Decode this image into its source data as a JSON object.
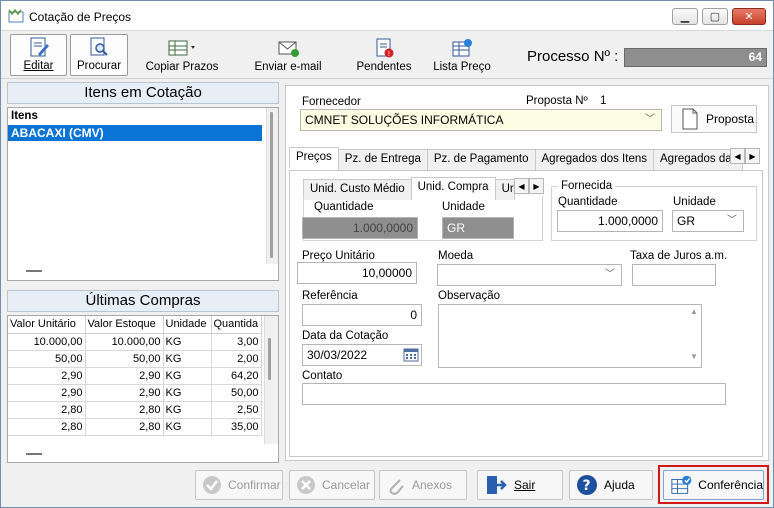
{
  "window": {
    "title": "Cotação de Preços"
  },
  "toolbar": {
    "editar": "Editar",
    "procurar": "Procurar",
    "copiar_prazos": "Copiar Prazos",
    "enviar_email": "Enviar e-mail",
    "pendentes": "Pendentes",
    "lista_preco": "Lista Preço"
  },
  "processo": {
    "label": "Processo Nº :",
    "value": "64"
  },
  "itens": {
    "header": "Itens em Cotação",
    "column": "Itens",
    "items": [
      "ABACAXI (CMV)"
    ]
  },
  "ultimas": {
    "header": "Últimas Compras",
    "columns": [
      "Valor Unitário",
      "Valor Estoque",
      "Unidade",
      "Quantida"
    ],
    "rows": [
      [
        "10.000,00",
        "10.000,00",
        "KG",
        "3,00"
      ],
      [
        "50,00",
        "50,00",
        "KG",
        "2,00"
      ],
      [
        "2,90",
        "2,90",
        "KG",
        "64,20"
      ],
      [
        "2,90",
        "2,90",
        "KG",
        "50,00"
      ],
      [
        "2,80",
        "2,80",
        "KG",
        "2,50"
      ],
      [
        "2,80",
        "2,80",
        "KG",
        "35,00"
      ]
    ]
  },
  "fornecedor": {
    "label": "Fornecedor",
    "value": "CMNET SOLUÇÕES INFORMÁTICA",
    "proposta_label": "Proposta Nº",
    "proposta_num": "1",
    "proposta_button": "Proposta"
  },
  "tabs": [
    "Preços",
    "Pz. de Entrega",
    "Pz. de Pagamento",
    "Agregados dos Itens",
    "Agregados da C"
  ],
  "subtabs": [
    "Unid. Custo Médio",
    "Unid. Compra",
    "Ur"
  ],
  "unid_compra": {
    "quantidade_label": "Quantidade",
    "quantidade": "1.000,0000",
    "unidade_label": "Unidade",
    "unidade": "GR"
  },
  "fornecida": {
    "title": "Fornecida",
    "quantidade_label": "Quantidade",
    "quantidade": "1.000,0000",
    "unidade_label": "Unidade",
    "unidade": "GR"
  },
  "form": {
    "preco_label": "Preço Unitário",
    "preco": "10,00000",
    "moeda_label": "Moeda",
    "moeda": "",
    "taxa_label": "Taxa de Juros a.m.",
    "taxa": "",
    "referencia_label": "Referência",
    "referencia": "0",
    "observacao_label": "Observação",
    "data_label": "Data da Cotação",
    "data": "30/03/2022",
    "contato_label": "Contato",
    "contato": ""
  },
  "buttons": {
    "confirmar": "Confirmar",
    "cancelar": "Cancelar",
    "anexos": "Anexos",
    "sair": "Sair",
    "ajuda": "Ajuda",
    "conferencia": "Conferência"
  },
  "colors": {
    "highlight": "#d01818",
    "selection": "#0a74d6",
    "fornecedor_bg": "#fdfde4"
  }
}
